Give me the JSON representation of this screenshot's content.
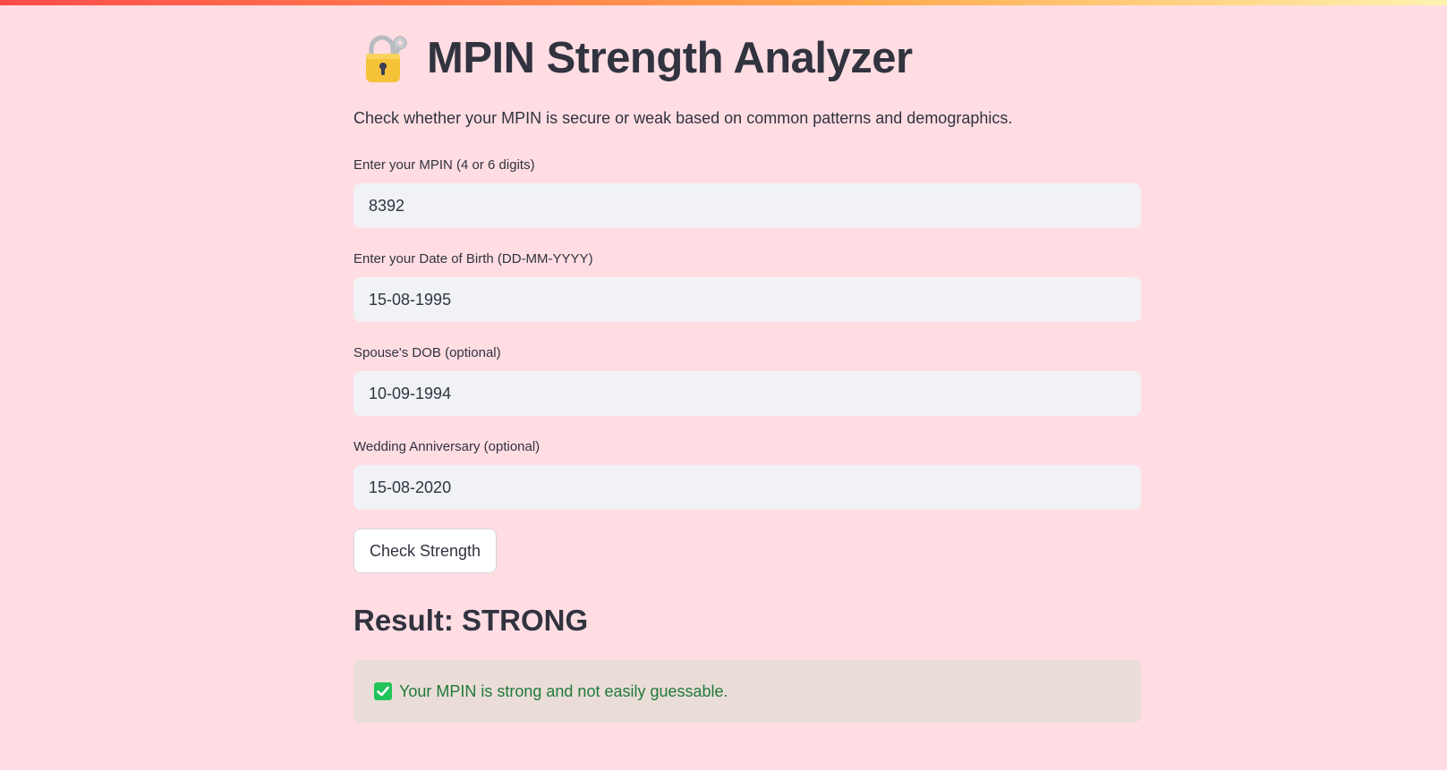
{
  "app": {
    "title": "MPIN Strength Analyzer",
    "title_icon": "lock-with-key-icon",
    "description": "Check whether your MPIN is secure or weak based on common patterns and demographics."
  },
  "form": {
    "mpin": {
      "label": "Enter your MPIN (4 or 6 digits)",
      "value": "8392"
    },
    "dob": {
      "label": "Enter your Date of Birth (DD-MM-YYYY)",
      "value": "15-08-1995"
    },
    "spouse_dob": {
      "label": "Spouse's DOB (optional)",
      "value": "10-09-1994"
    },
    "anniversary": {
      "label": "Wedding Anniversary (optional)",
      "value": "15-08-2020"
    },
    "submit_label": "Check Strength"
  },
  "result": {
    "heading": "Result: STRONG",
    "message": "Your MPIN is strong and not easily guessable.",
    "message_icon": "check-mark-icon"
  },
  "colors": {
    "background": "#ffdde3",
    "input_bg": "#f0f2f6",
    "success_bg": "#eaddd8",
    "success_text": "#1f7a39",
    "check_green": "#21c35a"
  }
}
